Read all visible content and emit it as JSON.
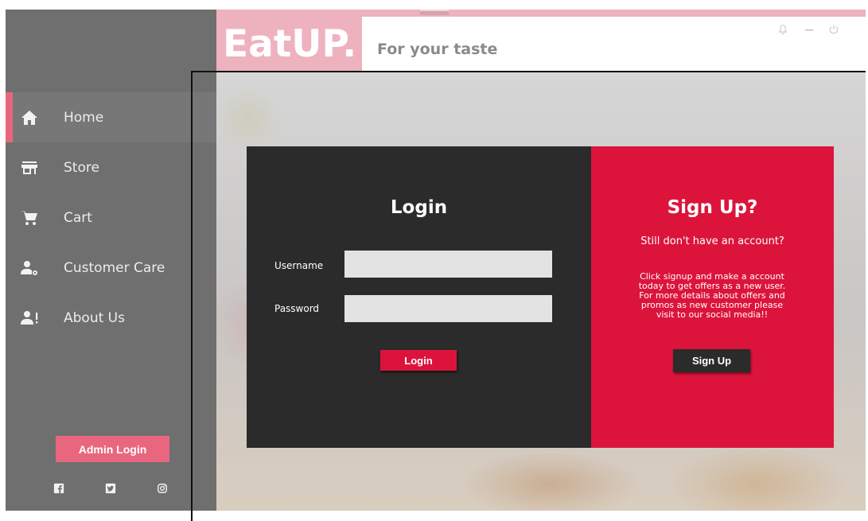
{
  "brand": {
    "logo": "EatUP.",
    "tagline": "For your taste",
    "accent": "#eeb2bf"
  },
  "header_icons": [
    "bell-icon",
    "minimize-icon",
    "power-icon"
  ],
  "sidebar": {
    "items": [
      {
        "label": "Home",
        "icon": "home-icon",
        "active": true
      },
      {
        "label": "Store",
        "icon": "store-icon",
        "active": false
      },
      {
        "label": "Cart",
        "icon": "cart-icon",
        "active": false
      },
      {
        "label": "Customer Care",
        "icon": "customer-care-icon",
        "active": false
      },
      {
        "label": "About Us",
        "icon": "about-us-icon",
        "active": false
      }
    ],
    "admin_login": "Admin Login",
    "socials": [
      "facebook-icon",
      "twitter-icon",
      "instagram-icon"
    ]
  },
  "login": {
    "title": "Login",
    "username_label": "Username",
    "username_value": "",
    "password_label": "Password",
    "password_value": "",
    "button": "Login"
  },
  "signup": {
    "title": "Sign Up?",
    "subtitle": "Still don't have an account?",
    "body_lines": [
      "Click signup and make a account",
      "today to get offers as a new user.",
      "For more details about offers and",
      "promos as new customer please",
      "visit to our social media!!"
    ],
    "button": "Sign Up"
  },
  "colors": {
    "sidebar": "#6f6f6f",
    "login_panel": "#2b2b2b",
    "signup_panel": "#dc143c",
    "active_marker": "#e8677f"
  }
}
